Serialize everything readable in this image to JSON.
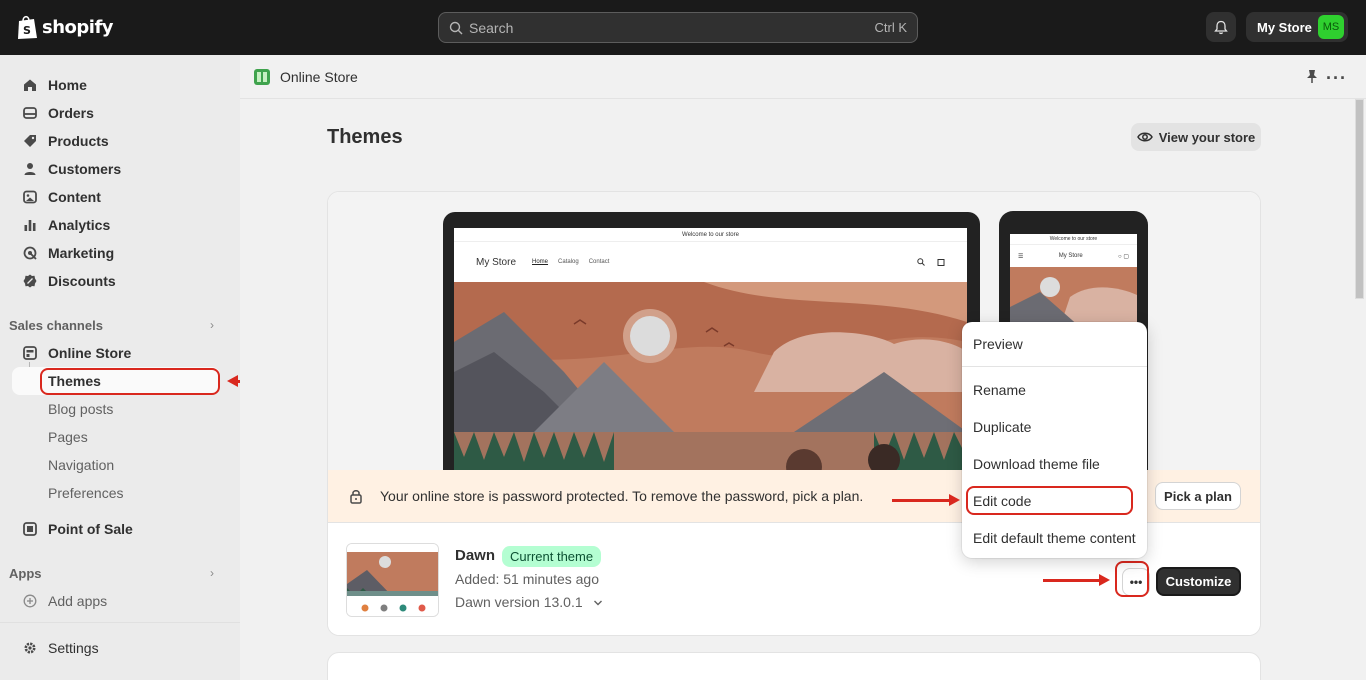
{
  "topbar": {
    "logo_text": "shopify",
    "search_placeholder": "Search",
    "search_shortcut": "Ctrl K",
    "store_name": "My Store",
    "avatar_initials": "MS"
  },
  "sidebar": {
    "items": [
      {
        "label": "Home",
        "icon": "home-icon"
      },
      {
        "label": "Orders",
        "icon": "orders-icon"
      },
      {
        "label": "Products",
        "icon": "tag-icon"
      },
      {
        "label": "Customers",
        "icon": "person-icon"
      },
      {
        "label": "Content",
        "icon": "content-icon"
      },
      {
        "label": "Analytics",
        "icon": "analytics-icon"
      },
      {
        "label": "Marketing",
        "icon": "target-icon"
      },
      {
        "label": "Discounts",
        "icon": "discount-icon"
      }
    ],
    "sales_channels_label": "Sales channels",
    "online_store_label": "Online Store",
    "sub_items": [
      "Themes",
      "Blog posts",
      "Pages",
      "Navigation",
      "Preferences"
    ],
    "pos_label": "Point of Sale",
    "apps_label": "Apps",
    "add_apps_label": "Add apps",
    "settings_label": "Settings"
  },
  "main": {
    "breadcrumb": "Online Store",
    "page_title": "Themes",
    "view_store_label": "View your store",
    "preview": {
      "announcement": "Welcome to our store",
      "store_name": "My Store",
      "nav_links": [
        "Home",
        "Catalog",
        "Contact"
      ]
    },
    "banner": {
      "message": "Your online store is password protected. To remove the password, pick a plan.",
      "button": "Pick a plan"
    },
    "theme": {
      "name": "Dawn",
      "badge": "Current theme",
      "added": "Added: 51 minutes ago",
      "version": "Dawn version 13.0.1",
      "customize_label": "Customize"
    },
    "menu": {
      "items": [
        "Preview",
        "Rename",
        "Duplicate",
        "Download theme file",
        "Edit code",
        "Edit default theme content"
      ]
    }
  },
  "colors": {
    "topbar_bg": "#1a1a1a",
    "annotation_red": "#d9281e",
    "badge_bg": "#b4fed2",
    "banner_bg": "#fff1e3",
    "avatar_bg": "#2fd02f"
  }
}
